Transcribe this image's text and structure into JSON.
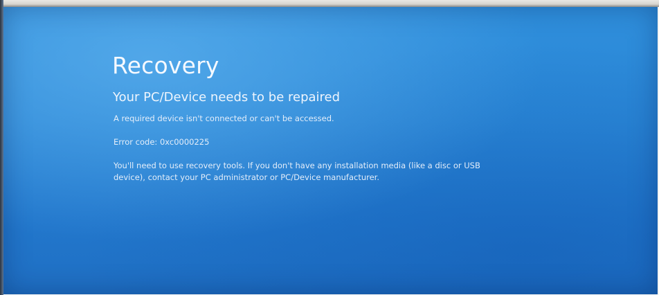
{
  "screen": {
    "title": "Recovery",
    "subtitle": "Your PC/Device needs to be repaired",
    "message": "A required device isn't connected or can't be accessed.",
    "error_code": "Error code: 0xc0000225",
    "instructions_line1": "You'll need to use recovery tools. If you don't have any installation media (like a disc or USB",
    "instructions_line2": "device), contact your PC administrator or PC/Device manufacturer."
  },
  "colors": {
    "background": "#2a86d6",
    "text": "#f2f7fd"
  }
}
